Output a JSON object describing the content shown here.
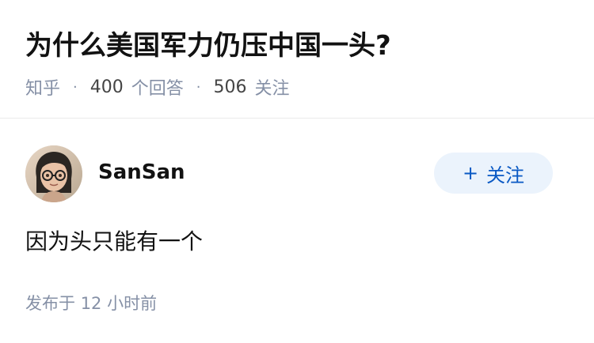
{
  "question": {
    "title": "为什么美国军力仍压中国一头?",
    "source": "知乎",
    "separator": "·",
    "answer_count": "400",
    "answer_count_label": "个回答",
    "follower_count": "506",
    "follower_count_label": "关注"
  },
  "answer": {
    "author_name": "SanSan",
    "follow_label": "关注",
    "follow_icon": "+",
    "content": "因为头只能有一个",
    "time_label": "发布于",
    "time_value": "12 小时前"
  },
  "colors": {
    "accent": "#0a59c4",
    "accent_bg": "#ebf3fc",
    "meta_text": "#8590a6",
    "divider": "#ebebeb"
  }
}
